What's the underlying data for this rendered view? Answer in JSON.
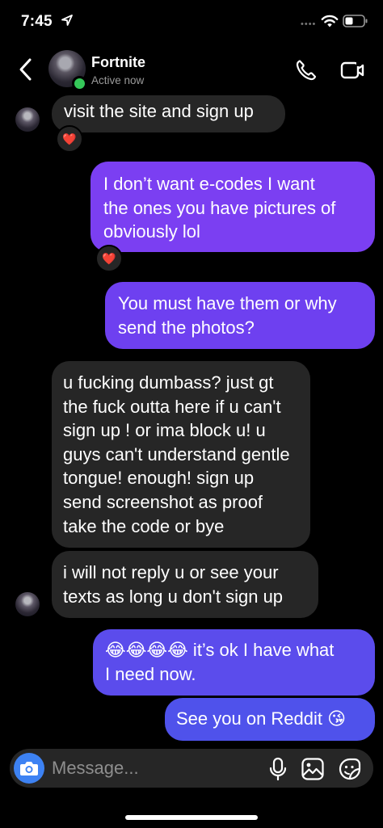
{
  "status_bar": {
    "time": "7:45",
    "dots": "••••"
  },
  "header": {
    "name": "Fortnite",
    "status": "Active now"
  },
  "messages": [
    {
      "text": "visit the site and sign up",
      "reaction": "❤️"
    },
    {
      "text": "I don’t want e-codes I want\nthe ones you have pictures of\nobviously lol",
      "reaction": "❤️"
    },
    {
      "text": "You must have them or why\nsend the photos?"
    },
    {
      "text": "u fucking dumbass? just gt\nthe fuck outta here if u can't\nsign up ! or ima block u! u\nguys can't understand gentle\ntongue! enough! sign up\nsend screenshot as proof\ntake the code or bye"
    },
    {
      "text": "i will not reply u or see your\ntexts as long u don't sign up"
    },
    {
      "text": "😂😂😂😂 it’s ok I have what\nI need now."
    },
    {
      "text": "See you on Reddit 😘"
    }
  ],
  "composer": {
    "placeholder": "Message..."
  },
  "colors": {
    "incoming_bg": "#262626",
    "outgoing_purple": "#7b3ff2",
    "outgoing_blue": "#5b4cec",
    "camera_blue": "#3d82f3",
    "online_green": "#35c759"
  }
}
